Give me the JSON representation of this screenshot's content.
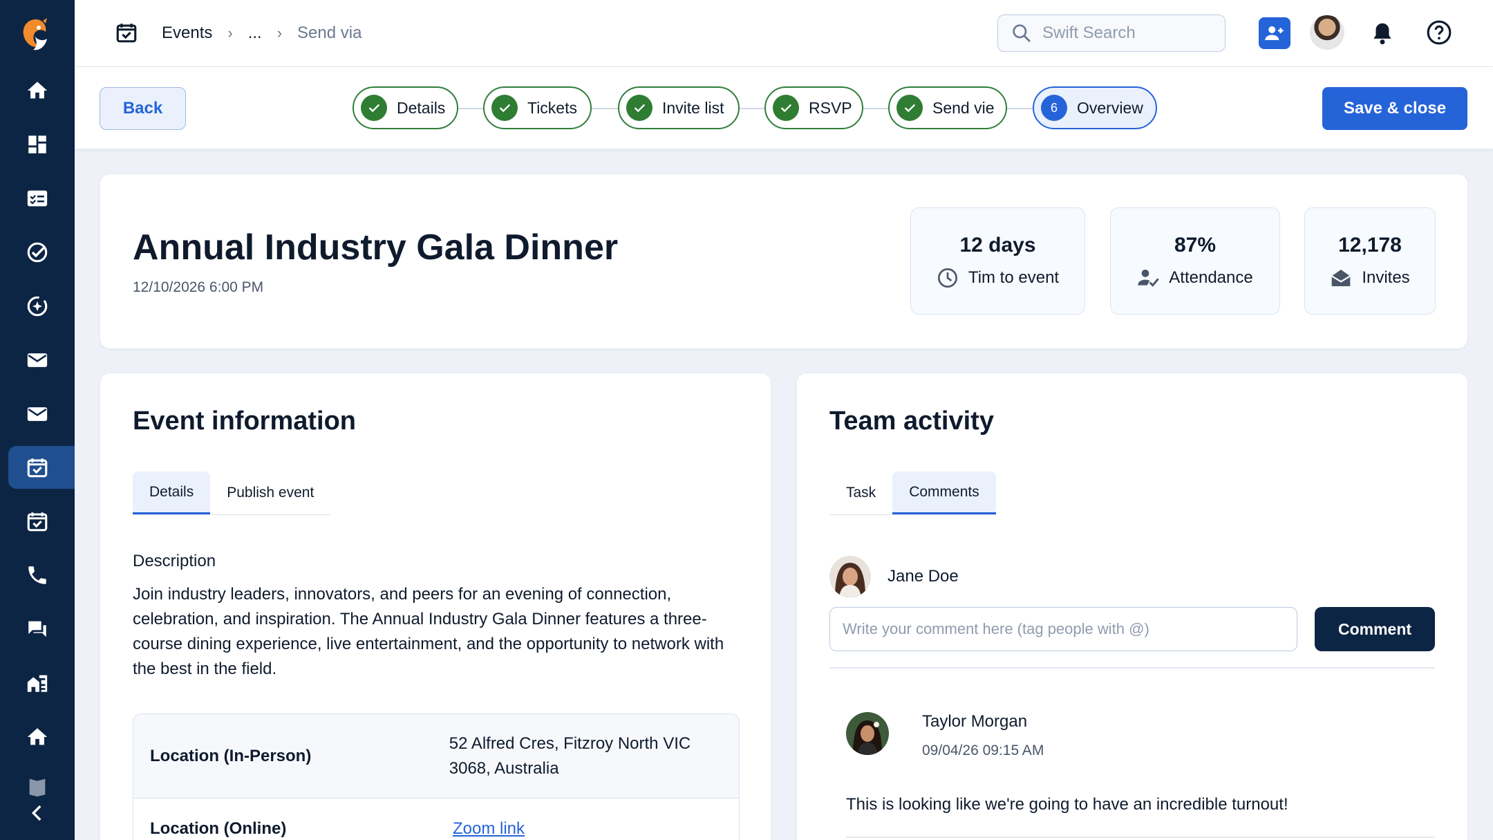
{
  "breadcrumb": {
    "first": "Events",
    "middle": "...",
    "current": "Send via"
  },
  "search": {
    "placeholder": "Swift Search"
  },
  "actions": {
    "back": "Back",
    "save": "Save & close"
  },
  "steps": [
    {
      "label": "Details",
      "status": "done"
    },
    {
      "label": "Tickets",
      "status": "done"
    },
    {
      "label": "Invite list",
      "status": "done"
    },
    {
      "label": "RSVP",
      "status": "done"
    },
    {
      "label": "Send vie",
      "status": "done"
    },
    {
      "label": "Overview",
      "status": "current",
      "number": "6"
    }
  ],
  "event": {
    "title": "Annual Industry Gala Dinner",
    "datetime": "12/10/2026 6:00 PM"
  },
  "stats": [
    {
      "value": "12 days",
      "label": "Tim to event",
      "icon": "clock-icon"
    },
    {
      "value": "87%",
      "label": "Attendance",
      "icon": "user-check-icon"
    },
    {
      "value": "12,178",
      "label": "Invites",
      "icon": "envelope-open-icon"
    }
  ],
  "info": {
    "heading": "Event information",
    "tabs": [
      "Details",
      "Publish event"
    ],
    "active_tab": "Details",
    "description_label": "Description",
    "description": "Join industry leaders, innovators, and peers for an evening of connection, celebration, and inspiration. The Annual Industry Gala Dinner features a three-course dining experience, live entertainment, and the opportunity to network with the best in the field.",
    "location_in_person_label": "Location (In-Person)",
    "location_in_person": "52 Alfred Cres, Fitzroy North VIC 3068, Australia",
    "location_online_label": "Location (Online)",
    "location_online": "Zoom link"
  },
  "team": {
    "heading": "Team activity",
    "tabs": [
      "Task",
      "Comments"
    ],
    "active_tab": "Comments",
    "current_user": "Jane Doe",
    "comment_placeholder": "Write your comment here  (tag people with @)",
    "comment_button": "Comment",
    "post": {
      "author": "Taylor Morgan",
      "time": "09/04/26 09:15 AM",
      "text": "This is looking like we're going to have an incredible turnout!"
    }
  },
  "colors": {
    "sidebar": "#0d2544",
    "primary": "#2563d8",
    "success": "#2e7d32",
    "sidebar_active": "#1f4f8f"
  }
}
